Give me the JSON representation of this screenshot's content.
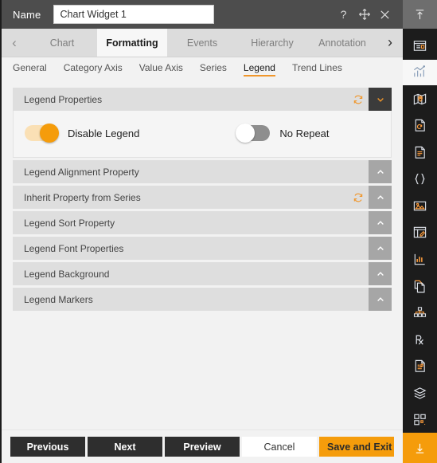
{
  "titlebar": {
    "name_label": "Name",
    "widget_name_value": "Chart Widget 1",
    "widget_name_placeholder": "Chart Widget 1",
    "help_icon": "question-mark-icon",
    "move_icon": "move-cross-arrows-icon",
    "close_icon": "close-x-icon"
  },
  "tabs": {
    "prev_arrow": "‹",
    "next_arrow": "›",
    "items": [
      {
        "label": "Chart",
        "active": false
      },
      {
        "label": "Formatting",
        "active": true
      },
      {
        "label": "Events",
        "active": false
      },
      {
        "label": "Hierarchy",
        "active": false
      },
      {
        "label": "Annotation",
        "active": false
      }
    ]
  },
  "subtabs": {
    "items": [
      {
        "label": "General",
        "active": false
      },
      {
        "label": "Category Axis",
        "active": false
      },
      {
        "label": "Value Axis",
        "active": false
      },
      {
        "label": "Series",
        "active": false
      },
      {
        "label": "Legend",
        "active": true
      },
      {
        "label": "Trend Lines",
        "active": false
      }
    ]
  },
  "panels": [
    {
      "title": "Legend Properties",
      "expanded": true,
      "has_refresh": true,
      "toggles": [
        {
          "label": "Disable Legend",
          "state": "on"
        },
        {
          "label": "No Repeat",
          "state": "off"
        }
      ]
    },
    {
      "title": "Legend Alignment Property",
      "expanded": false,
      "has_refresh": false
    },
    {
      "title": "Inherit Property from Series",
      "expanded": false,
      "has_refresh": true
    },
    {
      "title": "Legend Sort Property",
      "expanded": false,
      "has_refresh": false
    },
    {
      "title": "Legend Font Properties",
      "expanded": false,
      "has_refresh": false
    },
    {
      "title": "Legend Background",
      "expanded": false,
      "has_refresh": false
    },
    {
      "title": "Legend Markers",
      "expanded": false,
      "has_refresh": false
    }
  ],
  "footer": {
    "previous": "Previous",
    "next": "Next",
    "preview": "Preview",
    "cancel": "Cancel",
    "save_and_exit": "Save and Exit"
  },
  "rail": {
    "top_icon": "upload-arrow-icon",
    "bottom_icon": "download-arrow-icon",
    "items": [
      {
        "icon": "widget-panel-icon",
        "active": false
      },
      {
        "icon": "chart-bars-icon",
        "active": true
      },
      {
        "icon": "map-pin-icon",
        "active": false
      },
      {
        "icon": "document-refresh-icon",
        "active": false
      },
      {
        "icon": "document-lines-icon",
        "active": false
      },
      {
        "icon": "code-braces-icon",
        "active": false
      },
      {
        "icon": "image-picture-icon",
        "active": false
      },
      {
        "icon": "panel-edit-icon",
        "active": false
      },
      {
        "icon": "bar-graph-icon",
        "active": false
      },
      {
        "icon": "copy-pages-icon",
        "active": false
      },
      {
        "icon": "hierarchy-tree-icon",
        "active": false
      },
      {
        "icon": "prescription-rx-icon",
        "active": false
      },
      {
        "icon": "report-data-icon",
        "active": false
      },
      {
        "icon": "layers-stack-icon",
        "active": false
      },
      {
        "icon": "dashboard-grid-icon",
        "active": false
      }
    ]
  },
  "colors": {
    "accent": "#f59c0b",
    "titlebar_bg": "#4d4d4d",
    "rail_bg": "#1c1c1c",
    "panel_head_bg": "#dedede"
  }
}
